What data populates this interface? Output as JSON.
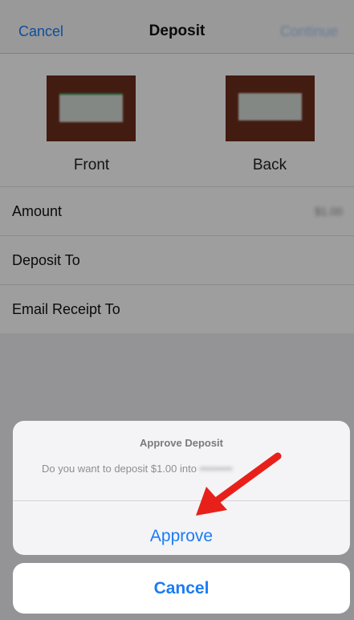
{
  "nav": {
    "cancel_label": "Cancel",
    "title": "Deposit",
    "continue_label": "Continue"
  },
  "checks": {
    "front_label": "Front",
    "back_label": "Back"
  },
  "form": {
    "rows": [
      {
        "label": "Amount",
        "value": "$1.00"
      },
      {
        "label": "Deposit To",
        "value": ""
      },
      {
        "label": "Email Receipt To",
        "value": ""
      }
    ]
  },
  "alert": {
    "title": "Approve Deposit",
    "message": "Do you want to deposit $1.00 into",
    "approve_label": "Approve",
    "cancel_label": "Cancel"
  },
  "colors": {
    "accent": "#1a7cf5",
    "annotation_arrow": "#e8201a"
  }
}
